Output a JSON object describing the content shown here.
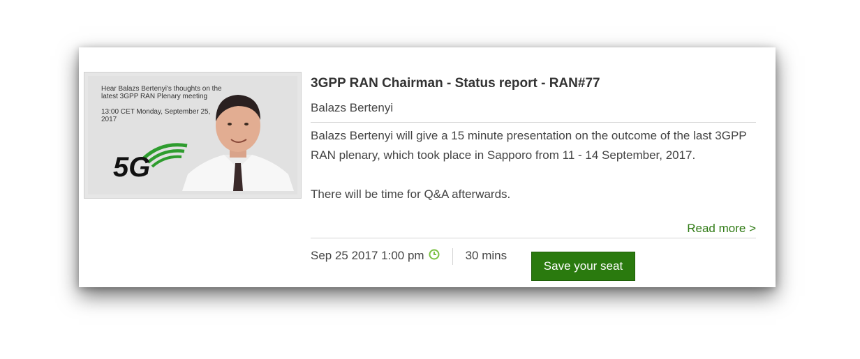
{
  "thumbnail": {
    "line1": "Hear Balazs Bertenyi's thoughts on the latest 3GPP RAN Plenary meeting",
    "line2": "13:00 CET Monday, September 25, 2017",
    "logo_text": "5G"
  },
  "webinar": {
    "title": "3GPP RAN Chairman - Status report - RAN#77",
    "author": "Balazs Bertenyi",
    "description": "Balazs Bertenyi will give a 15 minute presentation on the outcome of the last 3GPP RAN plenary, which took place in Sapporo from 11 - 14 September, 2017.",
    "qa_note": "There will be time for Q&A afterwards.",
    "read_more": "Read more >",
    "datetime": "Sep 25 2017 1:00 pm",
    "duration": "30 mins",
    "save_label": "Save your seat"
  },
  "colors": {
    "accent": "#2a7a0e",
    "link": "#2f7a14",
    "clock_icon": "#7ac142"
  }
}
